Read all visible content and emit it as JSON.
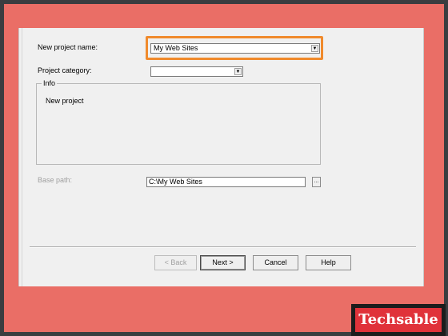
{
  "form": {
    "project_name_label": "New project name:",
    "project_name_value": "My Web Sites",
    "project_category_label": "Project category:",
    "project_category_value": "",
    "info_title": "Info",
    "info_text": "New project",
    "base_path_label": "Base path:",
    "base_path_value": "C:\\My Web Sites",
    "browse_label": "..."
  },
  "buttons": {
    "back": "< Back",
    "next": "Next >",
    "cancel": "Cancel",
    "help": "Help"
  },
  "watermark": {
    "text": "Techsable"
  },
  "colors": {
    "background_frame": "#ea6e66",
    "highlight": "#f08a2c",
    "logo_red": "#e0323a"
  }
}
